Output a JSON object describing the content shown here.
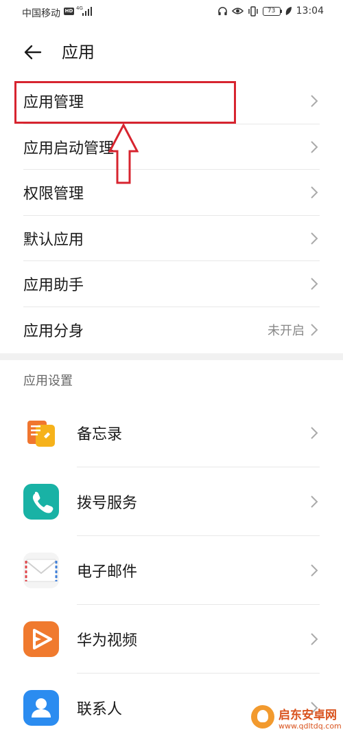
{
  "status_bar": {
    "carrier": "中国移动",
    "hd": "HD",
    "network": "4G",
    "battery": "73",
    "time": "13:04",
    "icons": [
      "headphones-icon",
      "eye-icon",
      "vibrate-icon",
      "battery-icon",
      "leaf-icon"
    ]
  },
  "header": {
    "title": "应用",
    "back_icon": "arrow-left-icon"
  },
  "menu": [
    {
      "label": "应用管理",
      "value": ""
    },
    {
      "label": "应用启动管理",
      "value": ""
    },
    {
      "label": "权限管理",
      "value": ""
    },
    {
      "label": "默认应用",
      "value": ""
    },
    {
      "label": "应用助手",
      "value": ""
    },
    {
      "label": "应用分身",
      "value": "未开启"
    }
  ],
  "section": {
    "title": "应用设置"
  },
  "apps": [
    {
      "label": "备忘录",
      "icon": "notes-icon",
      "color": "#f5a623"
    },
    {
      "label": "拨号服务",
      "icon": "phone-icon",
      "color": "#1fb5a8"
    },
    {
      "label": "电子邮件",
      "icon": "mail-icon",
      "color": "#f4f4f4"
    },
    {
      "label": "华为视频",
      "icon": "video-play-icon",
      "color": "#f07a2e"
    },
    {
      "label": "联系人",
      "icon": "contact-icon",
      "color": "#2b8cf0"
    }
  ],
  "annotation": {
    "highlight_color": "#d7242f"
  },
  "watermark": {
    "title": "启东安卓网",
    "url": "www.qdltdq.com"
  }
}
